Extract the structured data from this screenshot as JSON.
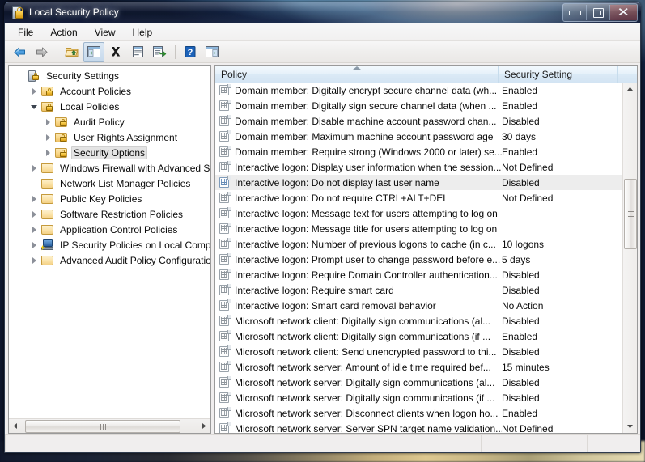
{
  "window": {
    "title": "Local Security Policy",
    "icon": "security-policy-icon",
    "controls": {
      "minimize": "Minimize",
      "maximize": "Maximize",
      "close": "Close"
    }
  },
  "menu": {
    "items": [
      {
        "label": "File",
        "name": "menu-file"
      },
      {
        "label": "Action",
        "name": "menu-action"
      },
      {
        "label": "View",
        "name": "menu-view"
      },
      {
        "label": "Help",
        "name": "menu-help"
      }
    ]
  },
  "toolbar": {
    "buttons": [
      {
        "icon": "back-arrow-icon",
        "label": "Back"
      },
      {
        "icon": "forward-arrow-icon",
        "label": "Forward"
      },
      {
        "icon": "up-one-level-folder-icon",
        "label": "Up One Level"
      },
      {
        "icon": "show-hide-console-tree-icon",
        "label": "Show/Hide Console Tree"
      },
      {
        "icon": "delete-x-icon",
        "label": "Delete"
      },
      {
        "icon": "properties-icon",
        "label": "Properties"
      },
      {
        "icon": "export-list-icon",
        "label": "Export List"
      },
      {
        "icon": "help-question-icon",
        "label": "Help"
      },
      {
        "icon": "show-hide-action-pane-icon",
        "label": "Show/Hide Action Pane"
      }
    ]
  },
  "tree": {
    "nodes": [
      {
        "label": "Security Settings",
        "indent": 0,
        "icon": "security-settings-icon",
        "twist": "none",
        "selected": false
      },
      {
        "label": "Account Policies",
        "indent": 1,
        "icon": "locked-folder-icon",
        "twist": "collapsed",
        "selected": false
      },
      {
        "label": "Local Policies",
        "indent": 1,
        "icon": "locked-folder-icon",
        "twist": "expanded",
        "selected": false
      },
      {
        "label": "Audit Policy",
        "indent": 2,
        "icon": "locked-folder-icon",
        "twist": "collapsed",
        "selected": false
      },
      {
        "label": "User Rights Assignment",
        "indent": 2,
        "icon": "locked-folder-icon",
        "twist": "collapsed",
        "selected": false
      },
      {
        "label": "Security Options",
        "indent": 2,
        "icon": "locked-folder-icon",
        "twist": "collapsed",
        "selected": true
      },
      {
        "label": "Windows Firewall with Advanced Secu",
        "indent": 1,
        "icon": "folder-icon",
        "twist": "collapsed",
        "selected": false
      },
      {
        "label": "Network List Manager Policies",
        "indent": 1,
        "icon": "folder-icon",
        "twist": "none",
        "selected": false
      },
      {
        "label": "Public Key Policies",
        "indent": 1,
        "icon": "folder-icon",
        "twist": "collapsed",
        "selected": false
      },
      {
        "label": "Software Restriction Policies",
        "indent": 1,
        "icon": "folder-icon",
        "twist": "collapsed",
        "selected": false
      },
      {
        "label": "Application Control Policies",
        "indent": 1,
        "icon": "folder-icon",
        "twist": "collapsed",
        "selected": false
      },
      {
        "label": "IP Security Policies on Local Compute",
        "indent": 1,
        "icon": "ip-security-computer-icon",
        "twist": "collapsed",
        "selected": false
      },
      {
        "label": "Advanced Audit Policy Configuration",
        "indent": 1,
        "icon": "folder-icon",
        "twist": "collapsed",
        "selected": false
      }
    ],
    "hscroll": {
      "left_arrow": "◀",
      "right_arrow": "▶"
    }
  },
  "list": {
    "columns": [
      {
        "label": "Policy",
        "sorted": true,
        "sort_direction": "asc"
      },
      {
        "label": "Security Setting",
        "sorted": false
      }
    ],
    "rows": [
      {
        "policy": "Domain member: Digitally encrypt secure channel data (wh...",
        "setting": "Enabled",
        "selected": false
      },
      {
        "policy": "Domain member: Digitally sign secure channel data (when ...",
        "setting": "Enabled",
        "selected": false
      },
      {
        "policy": "Domain member: Disable machine account password chan...",
        "setting": "Disabled",
        "selected": false
      },
      {
        "policy": "Domain member: Maximum machine account password age",
        "setting": "30 days",
        "selected": false
      },
      {
        "policy": "Domain member: Require strong (Windows 2000 or later) se...",
        "setting": "Enabled",
        "selected": false
      },
      {
        "policy": "Interactive logon: Display user information when the session...",
        "setting": "Not Defined",
        "selected": false
      },
      {
        "policy": "Interactive logon: Do not display last user name",
        "setting": "Disabled",
        "selected": true
      },
      {
        "policy": "Interactive logon: Do not require CTRL+ALT+DEL",
        "setting": "Not Defined",
        "selected": false
      },
      {
        "policy": "Interactive logon: Message text for users attempting to log on",
        "setting": "",
        "selected": false
      },
      {
        "policy": "Interactive logon: Message title for users attempting to log on",
        "setting": "",
        "selected": false
      },
      {
        "policy": "Interactive logon: Number of previous logons to cache (in c...",
        "setting": "10 logons",
        "selected": false
      },
      {
        "policy": "Interactive logon: Prompt user to change password before e...",
        "setting": "5 days",
        "selected": false
      },
      {
        "policy": "Interactive logon: Require Domain Controller authentication...",
        "setting": "Disabled",
        "selected": false
      },
      {
        "policy": "Interactive logon: Require smart card",
        "setting": "Disabled",
        "selected": false
      },
      {
        "policy": "Interactive logon: Smart card removal behavior",
        "setting": "No Action",
        "selected": false
      },
      {
        "policy": "Microsoft network client: Digitally sign communications (al...",
        "setting": "Disabled",
        "selected": false
      },
      {
        "policy": "Microsoft network client: Digitally sign communications (if ...",
        "setting": "Enabled",
        "selected": false
      },
      {
        "policy": "Microsoft network client: Send unencrypted password to thi...",
        "setting": "Disabled",
        "selected": false
      },
      {
        "policy": "Microsoft network server: Amount of idle time required bef...",
        "setting": "15 minutes",
        "selected": false
      },
      {
        "policy": "Microsoft network server: Digitally sign communications (al...",
        "setting": "Disabled",
        "selected": false
      },
      {
        "policy": "Microsoft network server: Digitally sign communications (if ...",
        "setting": "Disabled",
        "selected": false
      },
      {
        "policy": "Microsoft network server: Disconnect clients when logon ho...",
        "setting": "Enabled",
        "selected": false
      },
      {
        "policy": "Microsoft network server: Server SPN target name validation...",
        "setting": "Not Defined",
        "selected": false
      }
    ]
  },
  "statusbar": {
    "text": ""
  },
  "colors": {
    "header_blue": "#dbeaf6",
    "selection_gray": "#ededed",
    "window_chrome": "#f0eeee",
    "folder_yellow": "#f8d687",
    "lock_gold": "#ffd95f"
  }
}
